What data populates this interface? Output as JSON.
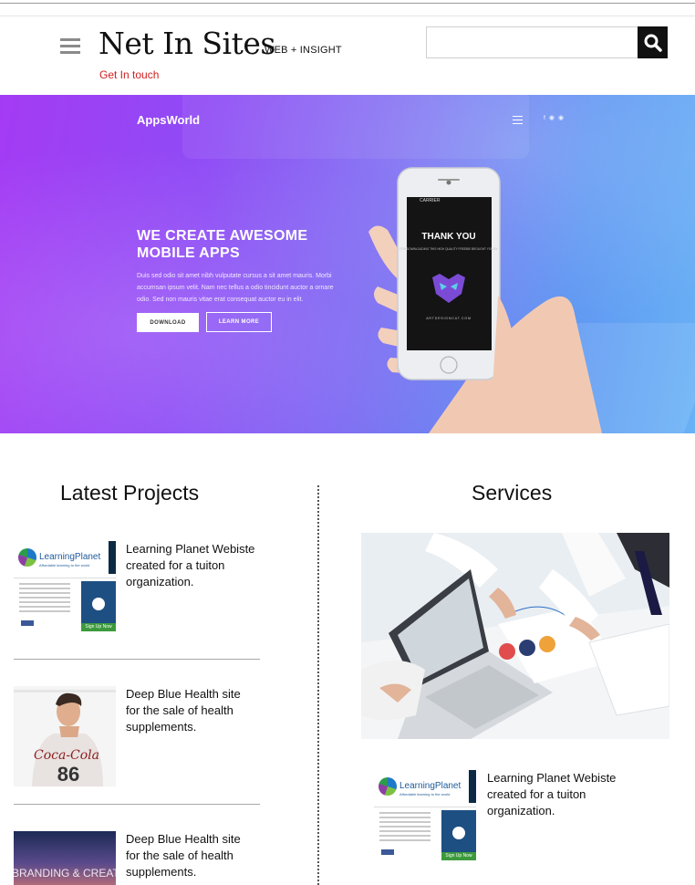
{
  "header": {
    "site_title": "Net In Sites",
    "tagline": "WEB + INSIGHT",
    "contact_link": "Get In touch",
    "search": {
      "placeholder": "",
      "value": ""
    }
  },
  "hero": {
    "brand": "AppsWorld",
    "headline_line1": "WE CREATE AWESOME",
    "headline_line2": "MOBILE APPS",
    "body": "Duis sed odio sit amet nibh vulputate cursus a sit amet mauris. Morbi accumsan ipsum velit. Nam nec tellus a odio tincidunt auctor a ornare odio. Sed non mauris vitae erat consequat auctor eu in elit.",
    "download_label": "DOWNLOAD",
    "learn_more_label": "LEARN MORE",
    "phone_screen_title": "THANK YOU",
    "phone_screen_sub": "FOR DOWNLOADING THIS HIGH QUALITY FREEBIE BROUGHT YOU BY",
    "phone_screen_site": "ARTDESIGNCAT.COM",
    "phone_carrier": "CARRIER"
  },
  "latest_projects": {
    "title": "Latest Projects",
    "items": [
      {
        "text": "Learning Planet Webiste created for a tuiton organization."
      },
      {
        "text": "Deep Blue Health site for the sale of health supplements."
      },
      {
        "text": "Deep Blue Health site for the sale of health supplements."
      }
    ]
  },
  "thumbnails": {
    "learning_planet_logo": "LearningPlanet",
    "learning_planet_sub": "Affordable learning to the world",
    "learning_planet_signup": "Sign Up Now",
    "shirt_text": "Coca-Cola",
    "shirt_number": "86",
    "branding_text": "BRANDING & CREATIVE"
  },
  "services": {
    "title": "Services",
    "item_text": "Learning Planet Webiste created for a tuiton organization."
  },
  "colors": {
    "accent_red": "#d01f1f",
    "hero_start": "#a43bf4",
    "hero_end": "#69b2f5"
  }
}
